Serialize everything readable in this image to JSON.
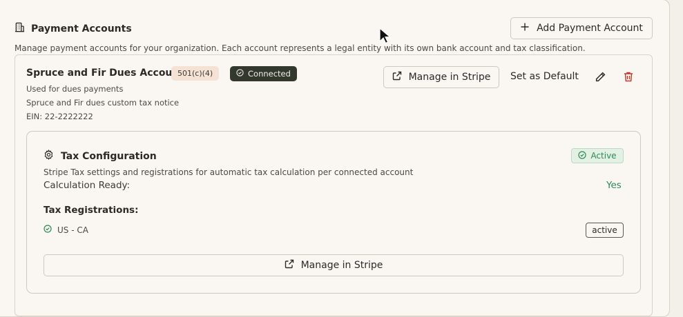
{
  "section": {
    "title": "Payment Accounts",
    "description": "Manage payment accounts for your organization. Each account represents a legal entity with its own bank account and tax classification.",
    "add_button": "Add Payment Account"
  },
  "account": {
    "name": "Spruce and Fir Dues Account",
    "tax_badge": "501(c)(4)",
    "status_badge": "Connected",
    "purpose": "Used for dues payments",
    "tax_notice": "Spruce and Fir dues custom tax notice",
    "ein": "EIN: 22-2222222",
    "manage_button": "Manage in Stripe",
    "set_default": "Set as Default"
  },
  "tax_config": {
    "title": "Tax Configuration",
    "status": "Active",
    "description": "Stripe Tax settings and registrations for automatic tax calculation per connected account",
    "calc_label": "Calculation Ready:",
    "calc_value": "Yes",
    "registrations_title": "Tax Registrations:",
    "registrations": [
      {
        "region": "US - CA",
        "status": "active"
      }
    ],
    "manage_button": "Manage in Stripe"
  },
  "colors": {
    "success": "#2c8a55",
    "danger": "#c0392b",
    "dark_badge": "#33382d"
  }
}
